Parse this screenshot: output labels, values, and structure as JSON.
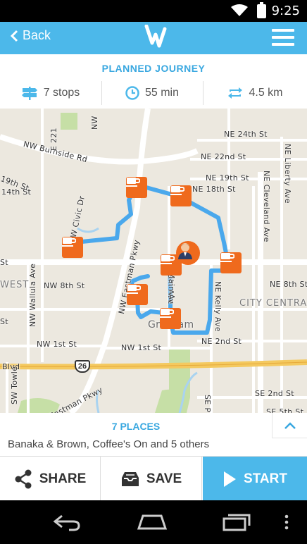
{
  "status_bar": {
    "time": "9:25"
  },
  "top_bar": {
    "back_label": "Back"
  },
  "journey": {
    "title": "PLANNED JOURNEY",
    "stops": "7 stops",
    "duration": "55 min",
    "distance": "4.5 km"
  },
  "map": {
    "labels": {
      "burnside": "NW Burnside Rd",
      "ne24": "NE 24th St",
      "ne22": "NE 22nd St",
      "ne19": "NE 19th St",
      "ne18": "NE 18th St",
      "nw19": "19th St",
      "civic": "NW Civic Dr",
      "eastman": "NW Eastman Pkwy",
      "nmain": "N Main Ave",
      "main": "Main Av",
      "kelly": "NE Kelly Ave",
      "cleveland": "NE Cleveland Ave",
      "liberty": "NE Liberty Ave",
      "ne2nd": "NE 2nd St",
      "nw8": "NW 8th St",
      "ne8": "NE 8th St",
      "nw1": "NW 1st St",
      "nw1b": "NW 1st St",
      "west": "WEST",
      "citycentral": "CITY CENTRAL",
      "gresham": "Gresham",
      "wallula": "NW Wallula Ave",
      "hwy": "26",
      "blvd": "Blvd",
      "eastman2": "Eastman Pkwy",
      "se2": "SE 2nd St",
      "se5": "SE 5th St",
      "st": "St",
      "sw": "SW Towle",
      "st2": "St",
      "t": "t",
      "e221": "E 221",
      "nw": "NW",
      "nw14": "14th St",
      "se": "SE P",
      "st3": "St"
    },
    "route_color": "#4aa8ec",
    "pin_color": "#ef6a1d"
  },
  "places": {
    "count_label": "7 PLACES",
    "summary": "Banaka & Brown, Coffee's On and 5 others"
  },
  "actions": {
    "share": "SHARE",
    "save": "SAVE",
    "start": "START"
  }
}
